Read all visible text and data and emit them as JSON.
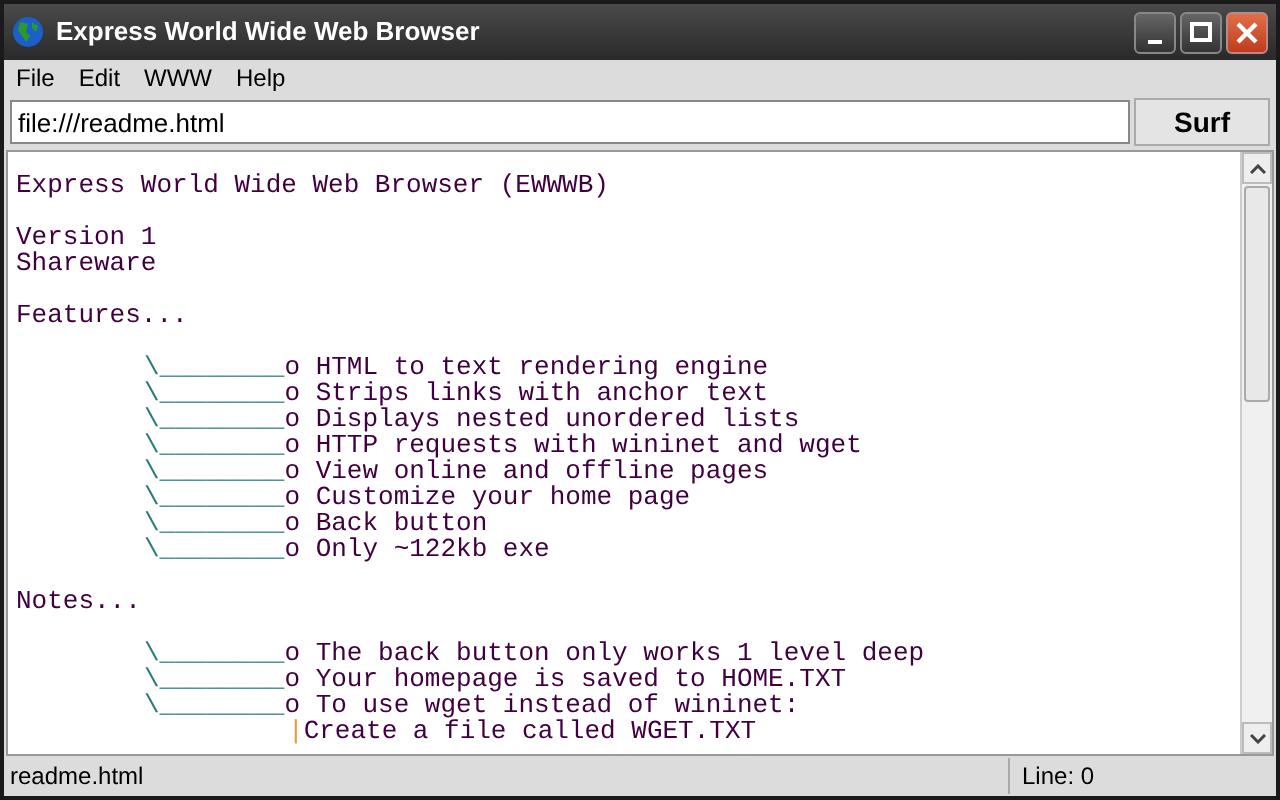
{
  "window": {
    "title": "Express World Wide Web Browser"
  },
  "menu": [
    "File",
    "Edit",
    "WWW",
    "Help"
  ],
  "address": {
    "value": "file:///readme.html"
  },
  "surf_button": "Surf",
  "document": [
    {
      "kind": "text",
      "text": "Express World Wide Web Browser (EWWWB)"
    },
    {
      "kind": "blank"
    },
    {
      "kind": "text",
      "text": "Version 1"
    },
    {
      "kind": "text",
      "text": "Shareware"
    },
    {
      "kind": "blank"
    },
    {
      "kind": "text",
      "text": "Features..."
    },
    {
      "kind": "blank"
    },
    {
      "kind": "bullet",
      "branch": "\\________",
      "marker": "o",
      "text": "HTML to text rendering engine"
    },
    {
      "kind": "bullet",
      "branch": "\\________",
      "marker": "o",
      "text": "Strips links with anchor text"
    },
    {
      "kind": "bullet",
      "branch": "\\________",
      "marker": "o",
      "text": "Displays nested unordered lists"
    },
    {
      "kind": "bullet",
      "branch": "\\________",
      "marker": "o",
      "text": "HTTP requests with wininet and wget"
    },
    {
      "kind": "bullet",
      "branch": "\\________",
      "marker": "o",
      "text": "View online and offline pages"
    },
    {
      "kind": "bullet",
      "branch": "\\________",
      "marker": "o",
      "text": "Customize your home page"
    },
    {
      "kind": "bullet",
      "branch": "\\________",
      "marker": "o",
      "text": "Back button"
    },
    {
      "kind": "bullet",
      "branch": "\\________",
      "marker": "o",
      "text": "Only ~122kb exe"
    },
    {
      "kind": "blank"
    },
    {
      "kind": "text",
      "text": "Notes..."
    },
    {
      "kind": "blank"
    },
    {
      "kind": "bullet",
      "branch": "\\________",
      "marker": "o",
      "text": "The back button only works 1 level deep"
    },
    {
      "kind": "bullet",
      "branch": "\\________",
      "marker": "o",
      "text": "Your homepage is saved to HOME.TXT"
    },
    {
      "kind": "bullet",
      "branch": "\\________",
      "marker": "o",
      "text": "To use wget instead of wininet:"
    },
    {
      "kind": "sub",
      "branch": "|",
      "text": "Create a file called WGET.TXT"
    }
  ],
  "status_bar": {
    "file": "readme.html",
    "line": "Line: 0"
  }
}
